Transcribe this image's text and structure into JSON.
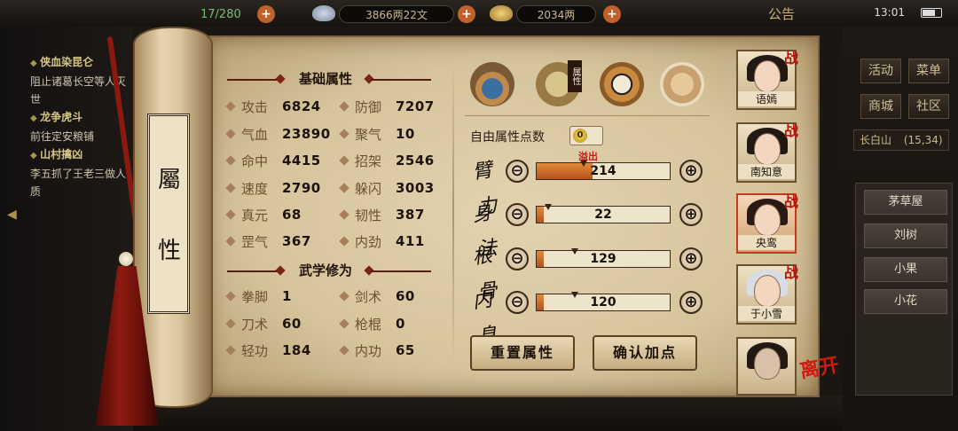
{
  "topbar": {
    "energy": "17/280",
    "copper": "3866两22文",
    "gold": "2034两",
    "notice": "公告",
    "clock": "13:01"
  },
  "quests": [
    {
      "title": "侠血染昆仑",
      "desc": "阻止诸葛长空等人灭世"
    },
    {
      "title": "龙争虎斗",
      "desc": "前往定安粮铺"
    },
    {
      "title": "山村擒凶",
      "desc": "李五抓了王老三做人质"
    }
  ],
  "right_menu": {
    "buttons": [
      "活动",
      "菜单",
      "商城",
      "社区"
    ],
    "location": "长白山",
    "coords": "(15,34)",
    "npcs": [
      "茅草屋",
      "刘树",
      "小果",
      "小花"
    ]
  },
  "scroll_title": [
    "屬",
    "性"
  ],
  "basic_attrs": {
    "header": "基础属性",
    "items": [
      {
        "label": "攻击",
        "value": "6824"
      },
      {
        "label": "防御",
        "value": "7207"
      },
      {
        "label": "气血",
        "value": "23890"
      },
      {
        "label": "聚气",
        "value": "10"
      },
      {
        "label": "命中",
        "value": "4415"
      },
      {
        "label": "招架",
        "value": "2546"
      },
      {
        "label": "速度",
        "value": "2790"
      },
      {
        "label": "躲闪",
        "value": "3003"
      },
      {
        "label": "真元",
        "value": "68"
      },
      {
        "label": "韧性",
        "value": "387"
      },
      {
        "label": "罡气",
        "value": "367"
      },
      {
        "label": "内劲",
        "value": "411"
      }
    ]
  },
  "martial": {
    "header": "武学修为",
    "items": [
      {
        "label": "拳脚",
        "value": "1"
      },
      {
        "label": "剑术",
        "value": "60"
      },
      {
        "label": "刀术",
        "value": "60"
      },
      {
        "label": "枪棍",
        "value": "0"
      },
      {
        "label": "轻功",
        "value": "184"
      },
      {
        "label": "内功",
        "value": "65"
      }
    ]
  },
  "tabs": {
    "active_badge": "属性",
    "icons": [
      "hat-icon",
      "book-icon",
      "yinyang-icon",
      "body-icon"
    ]
  },
  "free_points": {
    "label": "自由属性点数",
    "value": "0"
  },
  "alloc": {
    "overflow_tag": "溢出",
    "rows": [
      {
        "name": "臂力",
        "value": "214",
        "fill": 0.42
      },
      {
        "name": "身法",
        "value": "22",
        "fill": 0.05
      },
      {
        "name": "根骨",
        "value": "129",
        "fill": 0.05
      },
      {
        "name": "内息",
        "value": "120",
        "fill": 0.05
      }
    ],
    "minus": "⊖",
    "plus": "⊕"
  },
  "actions": {
    "reset": "重置属性",
    "confirm": "确认加点"
  },
  "party": {
    "battle_tag": "战",
    "members": [
      "语嫣",
      "南知意",
      "央鸾",
      "于小雪"
    ],
    "leave": "离开"
  },
  "colors": {
    "accent": "#b4531c",
    "overflow": "#c01c10",
    "paper": "#d6c49c"
  }
}
